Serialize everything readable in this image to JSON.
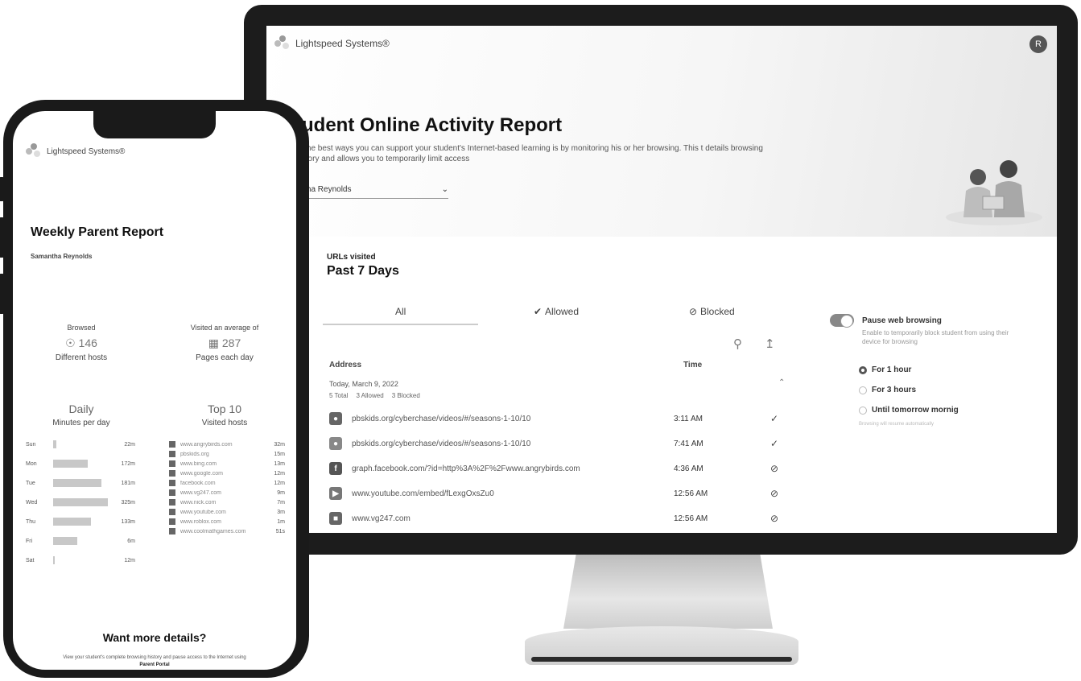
{
  "desktop": {
    "brand": "Lightspeed Systems®",
    "avatar_initial": "R",
    "title": "tudent Online Activity Report",
    "description": "of the best ways you can support your student's Internet-based learning is by monitoring his or her browsing. This t details browsing history and allows you to temporarily limit access",
    "student": "antha Reynolds",
    "urls_label": "URLs visited",
    "range": "Past 7 Days",
    "tabs": [
      {
        "label": "All",
        "icon": ""
      },
      {
        "label": "Allowed",
        "icon": "checkmark-icon"
      },
      {
        "label": "Blocked",
        "icon": "blocked-icon"
      }
    ],
    "columns": {
      "address": "Address",
      "time": "Time"
    },
    "day": {
      "label": "Today, March 9, 2022",
      "total": "5 Total",
      "allowed": "3 Allowed",
      "blocked": "3 Blocked"
    },
    "rows": [
      {
        "address": "pbskids.org/cyberchase/videos/#/seasons-1-10/10",
        "time": "3:11 AM",
        "status": "allowed",
        "icon_color": "#666",
        "icon": "pbs-icon"
      },
      {
        "address": "pbskids.org/cyberchase/videos/#/seasons-1-10/10",
        "time": "7:41 AM",
        "status": "allowed",
        "icon_color": "#888",
        "icon": "pbs-icon"
      },
      {
        "address": "graph.facebook.com/?id=http%3A%2F%2Fwww.angrybirds.com",
        "time": "4:36 AM",
        "status": "blocked",
        "icon_color": "#555",
        "icon": "facebook-icon"
      },
      {
        "address": "www.youtube.com/embed/fLexgOxsZu0",
        "time": "12:56 AM",
        "status": "blocked",
        "icon_color": "#777",
        "icon": "youtube-icon"
      },
      {
        "address": "www.vg247.com",
        "time": "12:56 AM",
        "status": "blocked",
        "icon_color": "#666",
        "icon": "site-icon"
      }
    ],
    "pause": {
      "title": "Pause web browsing",
      "description": "Enable to temporarily block student from using their device for browsing",
      "options": [
        "For 1 hour",
        "For 3 hours",
        "Until tomorrow mornig"
      ],
      "selected": 0,
      "footnote": "Browsing will resume automatically"
    }
  },
  "phone": {
    "brand": "Lightspeed Systems®",
    "title": "Weekly Parent Report",
    "student": "Samantha Reynolds",
    "stats": [
      {
        "key": "Browsed",
        "value": "146",
        "label": "Different hosts",
        "icon": "globe-icon"
      },
      {
        "key": "Visited an average of",
        "value": "287",
        "label": "Pages each day",
        "icon": "pages-icon"
      }
    ],
    "daily": {
      "title": "Daily",
      "subtitle": "Minutes per day",
      "days": [
        {
          "day": "Sun",
          "minutes": "22m",
          "fraction": 0.05
        },
        {
          "day": "Mon",
          "minutes": "172m",
          "fraction": 0.6
        },
        {
          "day": "Tue",
          "minutes": "181m",
          "fraction": 0.83
        },
        {
          "day": "Wed",
          "minutes": "325m",
          "fraction": 0.95
        },
        {
          "day": "Thu",
          "minutes": "133m",
          "fraction": 0.65
        },
        {
          "day": "Fri",
          "minutes": "6m",
          "fraction": 0.42
        },
        {
          "day": "Sat",
          "minutes": "12m",
          "fraction": 0.03
        }
      ]
    },
    "top": {
      "title": "Top 10",
      "subtitle": "Visited hosts",
      "hosts": [
        {
          "host": "www.angrybirds.com",
          "time": "32m"
        },
        {
          "host": "pbskids.org",
          "time": "15m"
        },
        {
          "host": "www.bing.com",
          "time": "13m"
        },
        {
          "host": "www.google.com",
          "time": "12m"
        },
        {
          "host": "facebook.com",
          "time": "12m"
        },
        {
          "host": "www.vg247.com",
          "time": "9m"
        },
        {
          "host": "www.nick.com",
          "time": "7m"
        },
        {
          "host": "www.youtube.com",
          "time": "3m"
        },
        {
          "host": "www.roblox.com",
          "time": "1m"
        },
        {
          "host": "www.coolmathgames.com",
          "time": "51s"
        }
      ]
    },
    "more_title": "Want more details?",
    "more_text": "View your student's complete browsing history and pause access to the Internet using",
    "portal": "Parent Portal"
  }
}
